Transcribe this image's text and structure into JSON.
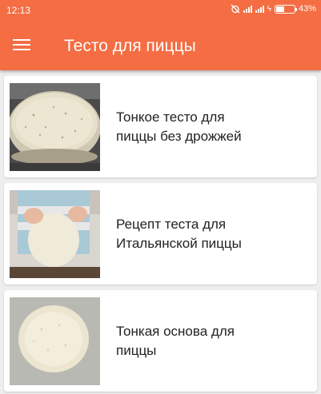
{
  "status_bar": {
    "time": "12:13",
    "battery_percent": "43%"
  },
  "app_bar": {
    "title": "Тесто для пиццы",
    "menu_icon": "hamburger-menu-icon"
  },
  "recipes": [
    {
      "title": "Тонкое тесто для\nпиццы без дрожжей"
    },
    {
      "title": "Рецепт теста для\nИтальянской пиццы"
    },
    {
      "title": "Тонкая основа для\nпиццы"
    }
  ],
  "colors": {
    "accent": "#f46d43",
    "background": "#eeeeee"
  }
}
